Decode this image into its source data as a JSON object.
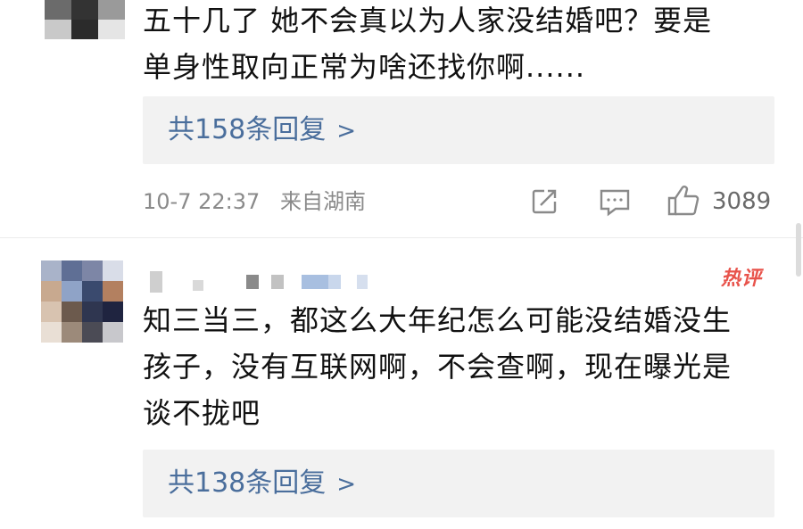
{
  "comments": [
    {
      "text_lines": [
        "五十几了 她不会真以为人家没结婚吧？要是",
        "单身性取向正常为啥还找你啊......"
      ],
      "replies_label": "共158条回复",
      "replies_chevron": ">",
      "time": "10-7 22:37",
      "location": "来自湖南",
      "likes": "3089"
    },
    {
      "badge": "热评",
      "text_lines": [
        "知三当三，都这么大年纪怎么可能没结婚没生",
        "孩子，没有互联网啊，不会查啊，现在曝光是",
        "谈不拢吧"
      ],
      "replies_label": "共138条回复",
      "replies_chevron": ">"
    }
  ],
  "icons": [
    "share-icon",
    "comment-icon",
    "like-icon"
  ],
  "colors": {
    "link": "#4a6e9c",
    "hot_badge": "#e8534b",
    "meta": "#8a8a8a",
    "reply_bg": "#f2f2f2"
  }
}
